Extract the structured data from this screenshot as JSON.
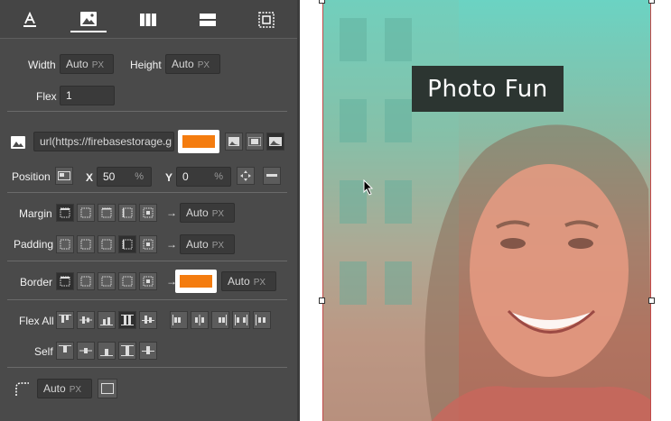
{
  "tabs": [
    {
      "id": "typography",
      "icon": "text-format-icon"
    },
    {
      "id": "background",
      "icon": "image-icon"
    },
    {
      "id": "columns",
      "icon": "columns-icon"
    },
    {
      "id": "rows",
      "icon": "rows-icon"
    },
    {
      "id": "spacing",
      "icon": "box-model-icon"
    }
  ],
  "size": {
    "width_label": "Width",
    "width_value": "Auto",
    "width_unit": "PX",
    "height_label": "Height",
    "height_value": "Auto",
    "height_unit": "PX",
    "flex_label": "Flex",
    "flex_value": "1"
  },
  "background": {
    "url": "url(https://firebasestorage.g",
    "more": "...",
    "color": "#f47c0f"
  },
  "position": {
    "label": "Position",
    "x_label": "X",
    "x_value": "50",
    "x_unit": "%",
    "y_label": "Y",
    "y_value": "0",
    "y_unit": "%"
  },
  "margin": {
    "label": "Margin",
    "arrow": "→",
    "value": "Auto",
    "unit": "PX"
  },
  "padding": {
    "label": "Padding",
    "arrow": "→",
    "value": "Auto",
    "unit": "PX"
  },
  "border": {
    "label": "Border",
    "arrow": "→",
    "color": "#f47c0f",
    "value": "Auto",
    "unit": "PX"
  },
  "flex_all": {
    "label": "Flex All"
  },
  "self": {
    "label": "Self"
  },
  "radius": {
    "value": "Auto",
    "unit": "PX"
  },
  "canvas": {
    "title": "Photo Fun",
    "selection_color": "#c24a4a"
  }
}
